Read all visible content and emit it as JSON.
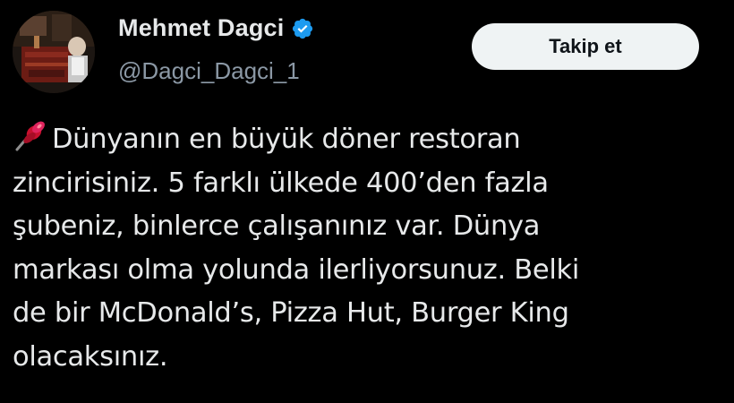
{
  "tweet": {
    "author": {
      "display_name": "Mehmet Dagci",
      "handle": "@Dagci_Dagci_1",
      "verified": true,
      "avatar_icon": "avatar-photo"
    },
    "follow_button": {
      "label": "Takip et"
    },
    "pin_icon": "pushpin-icon",
    "text": "Dünyanın en büyük döner restoran\nzincirisiniz. 5 farklı ülkede 400’den fazla\nşubeniz, binlerce çalışanınız var. Dünya\nmarkası olma yolunda ilerliyorsunuz. Belki\nde bir McDonald’s, Pizza Hut, Burger King\nolacaksınız."
  },
  "colors": {
    "background": "#000000",
    "primary_text": "#e7e9ea",
    "secondary_text": "#8b98a5",
    "verified_badge": "#1d9bf0",
    "button_bg": "#eff3f4",
    "button_text": "#0f1419",
    "pin": "#e0245e"
  }
}
